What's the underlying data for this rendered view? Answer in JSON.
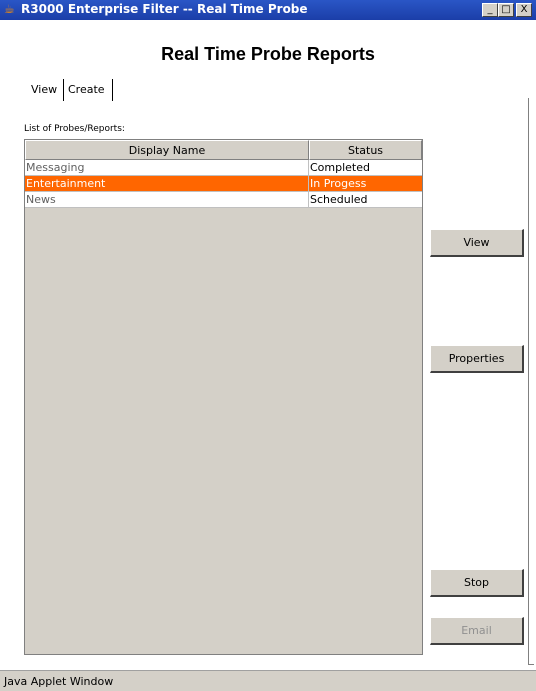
{
  "window": {
    "title": "R3000 Enterprise Filter -- Real Time Probe",
    "min_glyph": "_",
    "max_glyph": "□",
    "close_glyph": "X"
  },
  "page": {
    "title": "Real Time Probe Reports"
  },
  "tabs": [
    {
      "label": "View"
    },
    {
      "label": "Create"
    }
  ],
  "list": {
    "label": "List of Probes/Reports:",
    "columns": [
      "Display Name",
      "Status"
    ],
    "rows": [
      {
        "name": "Messaging",
        "status": "Completed",
        "selected": false
      },
      {
        "name": "Entertainment",
        "status": "In Progess",
        "selected": true
      },
      {
        "name": "News",
        "status": "Scheduled",
        "selected": false
      }
    ],
    "selected_color": "#ff6600"
  },
  "buttons": {
    "view": "View",
    "properties": "Properties",
    "stop": "Stop",
    "email": "Email"
  },
  "statusbar": {
    "text": "Java Applet Window"
  },
  "icons": {
    "app": "java-cup-icon"
  }
}
